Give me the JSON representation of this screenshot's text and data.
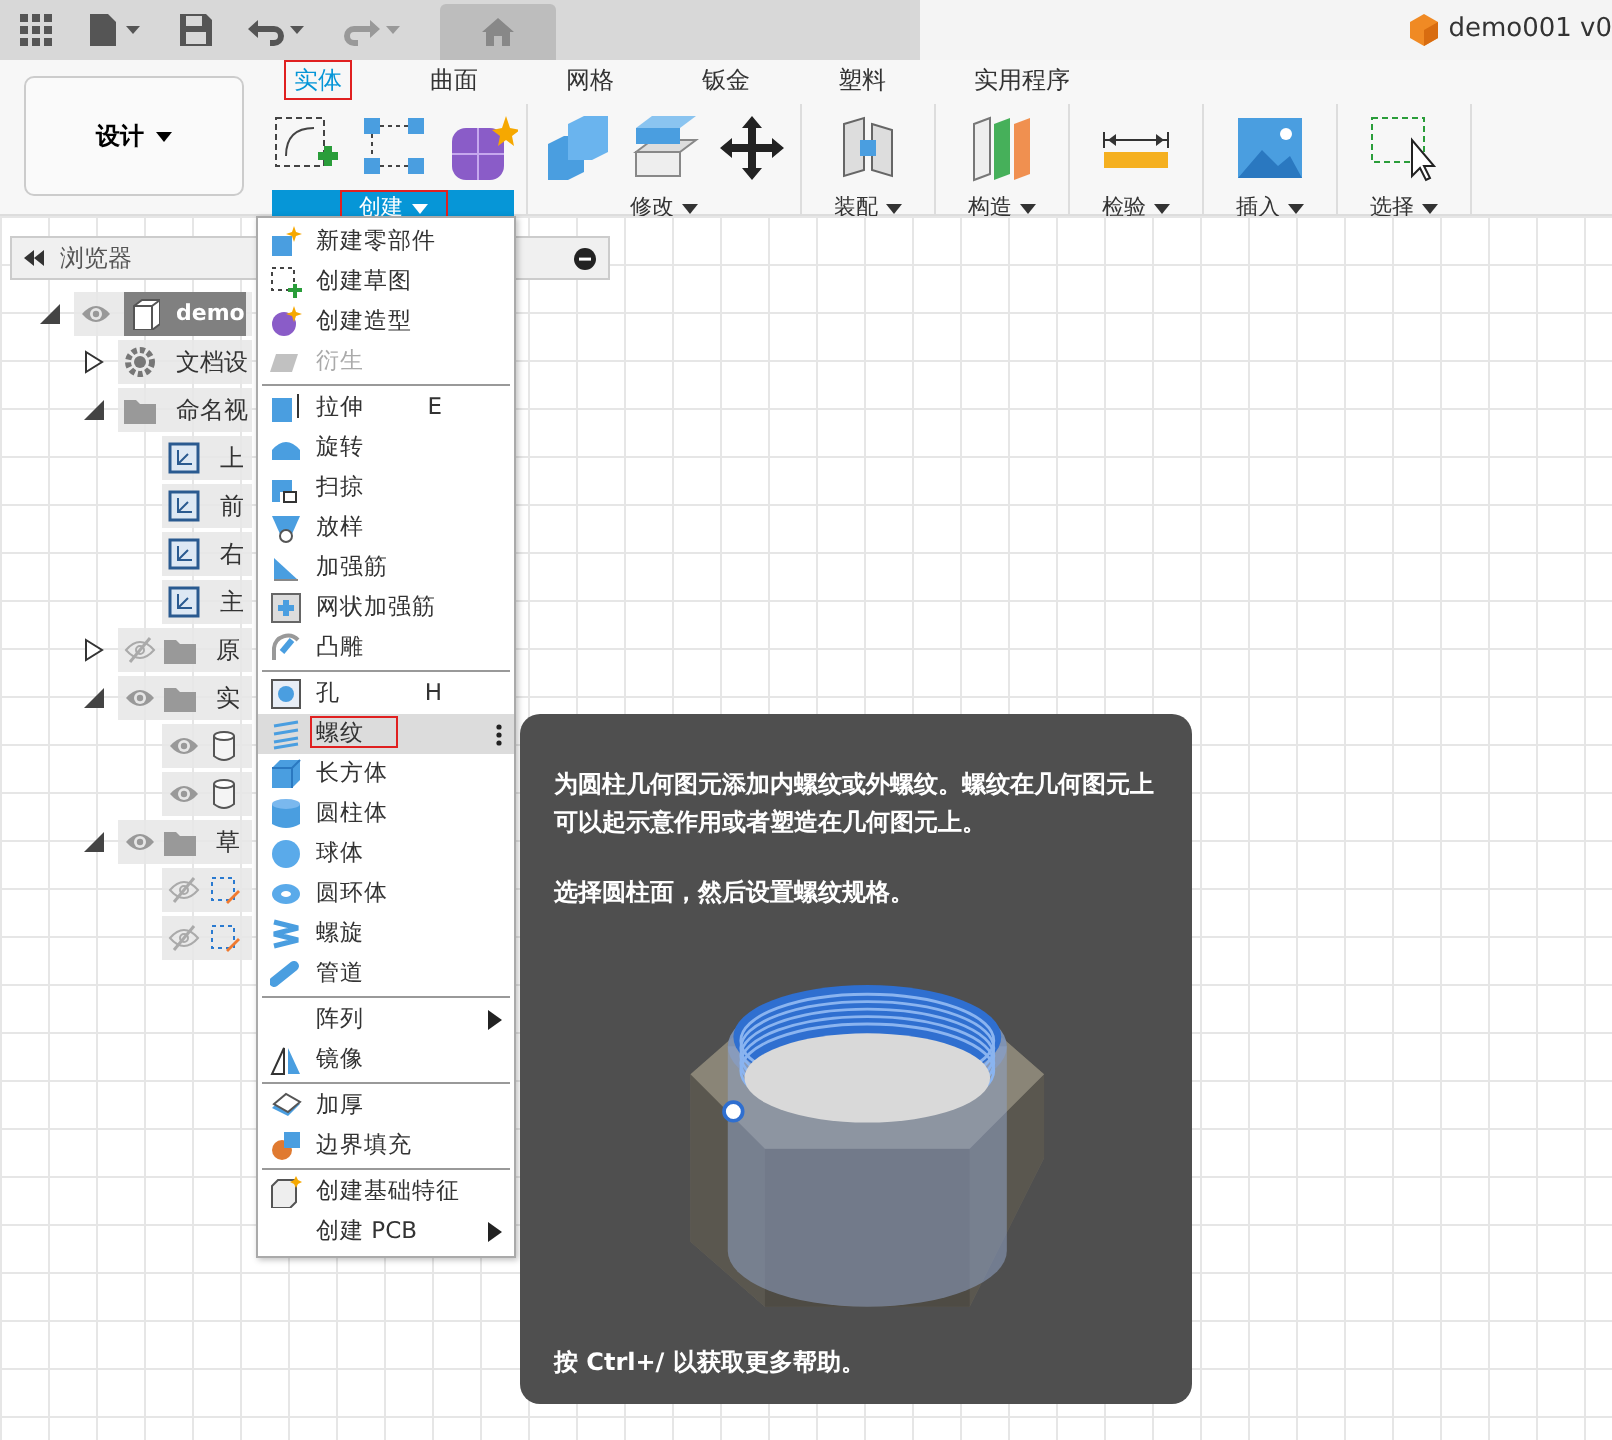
{
  "document_title": "demo001 v0",
  "design_button": {
    "label": "设计"
  },
  "tabs": [
    {
      "label": "实体",
      "selected": true,
      "outlined": true
    },
    {
      "label": "曲面",
      "selected": false,
      "outlined": false
    },
    {
      "label": "网格",
      "selected": false,
      "outlined": false
    },
    {
      "label": "钣金",
      "selected": false,
      "outlined": false
    },
    {
      "label": "塑料",
      "selected": false,
      "outlined": false
    },
    {
      "label": "实用程序",
      "selected": false,
      "outlined": false
    }
  ],
  "tool_groups": [
    {
      "label": "创建",
      "active": true,
      "outlined": true
    },
    {
      "label": "修改",
      "active": false,
      "outlined": false
    },
    {
      "label": "装配",
      "active": false,
      "outlined": false
    },
    {
      "label": "构造",
      "active": false,
      "outlined": false
    },
    {
      "label": "检验",
      "active": false,
      "outlined": false
    },
    {
      "label": "插入",
      "active": false,
      "outlined": false
    },
    {
      "label": "选择",
      "active": false,
      "outlined": false
    }
  ],
  "browser": {
    "title": "浏览器",
    "tree": [
      {
        "label": "demo",
        "kind": "component",
        "visible": true,
        "expanded": true,
        "selected": true,
        "children": [
          {
            "label": "文档设",
            "kind": "settings",
            "expanded": false,
            "selected": false
          },
          {
            "label": "命名视",
            "kind": "folder",
            "expanded": true,
            "selected": false,
            "children": [
              {
                "label": "上",
                "kind": "view",
                "selected": false
              },
              {
                "label": "前",
                "kind": "view",
                "selected": false
              },
              {
                "label": "右",
                "kind": "view",
                "selected": false
              },
              {
                "label": "主",
                "kind": "view",
                "selected": false
              }
            ]
          },
          {
            "label": "原",
            "kind": "folder",
            "visible": false,
            "expanded": false,
            "selected": false
          },
          {
            "label": "实",
            "kind": "folder",
            "visible": true,
            "expanded": true,
            "selected": false,
            "children": [
              {
                "kind": "body",
                "visible": true,
                "selected": false
              },
              {
                "kind": "body",
                "visible": true,
                "selected": false
              }
            ]
          },
          {
            "label": "草",
            "kind": "folder",
            "visible": true,
            "expanded": true,
            "selected": false,
            "children": [
              {
                "kind": "sketch",
                "visible": false,
                "selected": false
              },
              {
                "kind": "sketch",
                "visible": false,
                "selected": false
              }
            ]
          }
        ]
      }
    ]
  },
  "menu": [
    {
      "kind": "item",
      "label": "新建零部件",
      "disabled": false,
      "highlighted": false,
      "outlined": false
    },
    {
      "kind": "item",
      "label": "创建草图",
      "disabled": false,
      "highlighted": false,
      "outlined": false
    },
    {
      "kind": "item",
      "label": "创建造型",
      "disabled": false,
      "highlighted": false,
      "outlined": false
    },
    {
      "kind": "item",
      "label": "衍生",
      "disabled": true,
      "highlighted": false,
      "outlined": false
    },
    {
      "kind": "separator"
    },
    {
      "kind": "item",
      "label": "拉伸",
      "shortcut": "E",
      "disabled": false,
      "highlighted": false,
      "outlined": false
    },
    {
      "kind": "item",
      "label": "旋转",
      "disabled": false,
      "highlighted": false,
      "outlined": false
    },
    {
      "kind": "item",
      "label": "扫掠",
      "disabled": false,
      "highlighted": false,
      "outlined": false
    },
    {
      "kind": "item",
      "label": "放样",
      "disabled": false,
      "highlighted": false,
      "outlined": false
    },
    {
      "kind": "item",
      "label": "加强筋",
      "disabled": false,
      "highlighted": false,
      "outlined": false
    },
    {
      "kind": "item",
      "label": "网状加强筋",
      "disabled": false,
      "highlighted": false,
      "outlined": false
    },
    {
      "kind": "item",
      "label": "凸雕",
      "disabled": false,
      "highlighted": false,
      "outlined": false
    },
    {
      "kind": "separator"
    },
    {
      "kind": "item",
      "label": "孔",
      "shortcut": "H",
      "disabled": false,
      "highlighted": false,
      "outlined": false
    },
    {
      "kind": "item",
      "label": "螺纹",
      "disabled": false,
      "highlighted": true,
      "outlined": true
    },
    {
      "kind": "item",
      "label": "长方体",
      "disabled": false,
      "highlighted": false,
      "outlined": false
    },
    {
      "kind": "item",
      "label": "圆柱体",
      "disabled": false,
      "highlighted": false,
      "outlined": false
    },
    {
      "kind": "item",
      "label": "球体",
      "disabled": false,
      "highlighted": false,
      "outlined": false
    },
    {
      "kind": "item",
      "label": "圆环体",
      "disabled": false,
      "highlighted": false,
      "outlined": false
    },
    {
      "kind": "item",
      "label": "螺旋",
      "disabled": false,
      "highlighted": false,
      "outlined": false
    },
    {
      "kind": "item",
      "label": "管道",
      "disabled": false,
      "highlighted": false,
      "outlined": false
    },
    {
      "kind": "separator"
    },
    {
      "kind": "submenu",
      "label": "阵列",
      "disabled": false,
      "highlighted": false,
      "outlined": false
    },
    {
      "kind": "item",
      "label": "镜像",
      "disabled": false,
      "highlighted": false,
      "outlined": false
    },
    {
      "kind": "separator"
    },
    {
      "kind": "item",
      "label": "加厚",
      "disabled": false,
      "highlighted": false,
      "outlined": false
    },
    {
      "kind": "item",
      "label": "边界填充",
      "disabled": false,
      "highlighted": false,
      "outlined": false
    },
    {
      "kind": "separator"
    },
    {
      "kind": "item",
      "label": "创建基础特征",
      "disabled": false,
      "highlighted": false,
      "outlined": false
    },
    {
      "kind": "submenu",
      "label": "创建 PCB",
      "disabled": false,
      "highlighted": false,
      "outlined": false
    }
  ],
  "tooltip": {
    "paragraphs": [
      "为圆柱几何图元添加内螺纹或外螺纹。螺纹在几何图元上可以起示意作用或者塑造在几何图元上。",
      "选择圆柱面，然后设置螺纹规格。"
    ],
    "footer": "按 Ctrl+/ 以获取更多帮助。"
  }
}
